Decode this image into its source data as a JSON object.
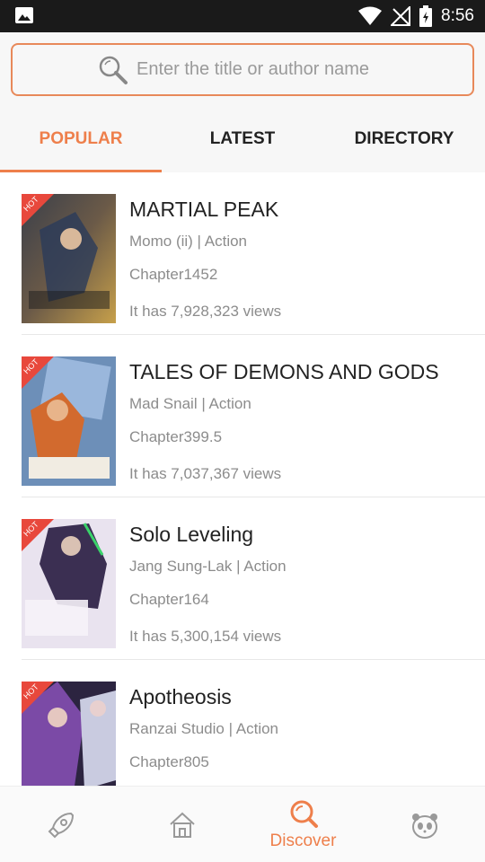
{
  "status_bar": {
    "time": "8:56",
    "icons": [
      "image-icon",
      "wifi-icon",
      "no-signal-icon",
      "battery-icon"
    ]
  },
  "search": {
    "placeholder": "Enter the title or author name"
  },
  "tabs": [
    {
      "label": "POPULAR",
      "active": true
    },
    {
      "label": "LATEST",
      "active": false
    },
    {
      "label": "DIRECTORY",
      "active": false
    }
  ],
  "badge": "HOT",
  "books": [
    {
      "title": "MARTIAL PEAK",
      "meta": "Momo (ii) | Action",
      "chapter": "Chapter1452",
      "views": "It has 7,928,323 views"
    },
    {
      "title": "TALES OF DEMONS AND GODS",
      "meta": "Mad Snail | Action",
      "chapter": "Chapter399.5",
      "views": "It has 7,037,367 views"
    },
    {
      "title": "Solo Leveling",
      "meta": "Jang Sung-Lak | Action",
      "chapter": "Chapter164",
      "views": "It has 5,300,154 views"
    },
    {
      "title": "Apotheosis",
      "meta": "Ranzai Studio | Action",
      "chapter": "Chapter805",
      "views": ""
    }
  ],
  "bottom_nav": [
    {
      "icon": "rocket-icon",
      "label": ""
    },
    {
      "icon": "home-icon",
      "label": ""
    },
    {
      "icon": "discover-icon",
      "label": "Discover"
    },
    {
      "icon": "panda-icon",
      "label": ""
    }
  ],
  "colors": {
    "accent": "#ee7f4b",
    "hot_badge": "#e8483c",
    "status_bar": "#1a1a1a"
  }
}
